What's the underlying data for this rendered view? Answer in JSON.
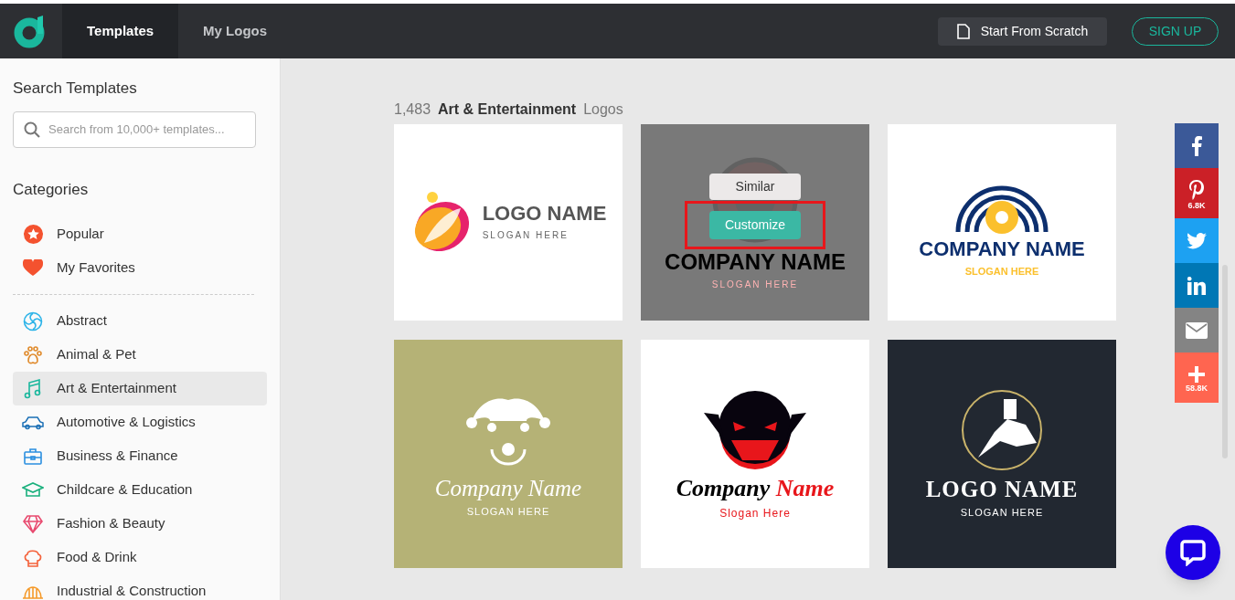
{
  "header": {
    "tabs": [
      {
        "label": "Templates",
        "selected": true
      },
      {
        "label": "My Logos",
        "selected": false
      }
    ],
    "start_button": "Start From Scratch",
    "signup_button": "SIGN UP"
  },
  "sidebar": {
    "search_title": "Search Templates",
    "search": {
      "placeholder": "Search from 10,000+ templates..."
    },
    "categories_title": "Categories",
    "pinned": [
      {
        "label": "Popular",
        "selected": false
      },
      {
        "label": "My Favorites",
        "selected": false
      }
    ],
    "items": [
      {
        "label": "Abstract",
        "selected": false
      },
      {
        "label": "Animal & Pet",
        "selected": false
      },
      {
        "label": "Art & Entertainment",
        "selected": true
      },
      {
        "label": "Automotive & Logistics",
        "selected": false
      },
      {
        "label": "Business & Finance",
        "selected": false
      },
      {
        "label": "Childcare & Education",
        "selected": false
      },
      {
        "label": "Fashion & Beauty",
        "selected": false
      },
      {
        "label": "Food & Drink",
        "selected": false
      },
      {
        "label": "Industrial & Construction",
        "selected": false
      }
    ]
  },
  "results": {
    "count": "1,483",
    "category": "Art & Entertainment",
    "suffix": "Logos"
  },
  "cards": [
    {
      "kind": "feather",
      "name": "LOGO NAME",
      "slogan": "SLOGAN HERE",
      "hovered": false
    },
    {
      "kind": "vampire-ring",
      "name": "COMPANY NAME",
      "slogan": "SLOGAN HERE",
      "hovered": true,
      "similar_button": "Similar",
      "customize_button": "Customize",
      "highlighted": true
    },
    {
      "kind": "aperture",
      "name": "COMPANY NAME",
      "slogan": "SLOGAN HERE",
      "hovered": false
    },
    {
      "kind": "jester",
      "name": "Company Name",
      "slogan": "SLOGAN HERE",
      "hovered": false
    },
    {
      "kind": "vampire",
      "name": "Company",
      "name_accent": "Name",
      "slogan": "Slogan Here",
      "hovered": false
    },
    {
      "kind": "tattoo",
      "name": "LOGO NAME",
      "slogan": "SLOGAN HERE",
      "hovered": false
    }
  ],
  "share": [
    {
      "kind": "facebook"
    },
    {
      "kind": "pinterest",
      "count": "6.8K"
    },
    {
      "kind": "twitter"
    },
    {
      "kind": "linkedin"
    },
    {
      "kind": "email"
    },
    {
      "kind": "more",
      "count": "58.8K"
    }
  ]
}
